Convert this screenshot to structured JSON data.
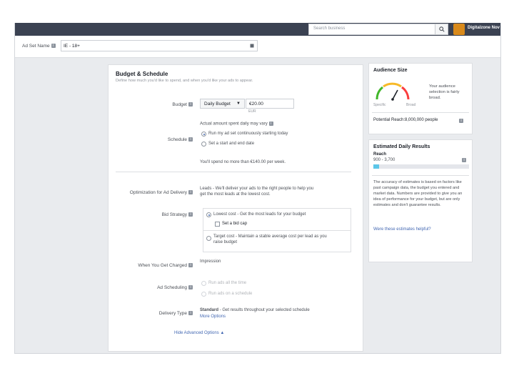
{
  "header": {
    "search_placeholder": "Search business",
    "avatar_text": "",
    "account_name": "Digitalzone Nov"
  },
  "adset": {
    "label": "Ad Set Name",
    "value": "IE - 18+"
  },
  "budget": {
    "title": "Budget & Schedule",
    "subtitle": "Define how much you'd like to spend, and when you'd like your ads to appear.",
    "budget_label": "Budget",
    "budget_type": "Daily Budget",
    "budget_amount": "€20.00",
    "currency": "EUR",
    "schedule_label": "Schedule",
    "actual_spend_note": "Actual amount spent daily may vary",
    "schedule_options": [
      "Run my ad set continuously starting today",
      "Set a start and end date"
    ],
    "spend_summary": "You'll spend no more than €140.00 per week."
  },
  "optimization": {
    "label": "Optimization for Ad Delivery",
    "text_line1": "Leads - We'll deliver your ads to the right people to help you",
    "text_line2": "get the most leads at the lowest cost."
  },
  "bid": {
    "label": "Bid Strategy",
    "lowest_cost": "Lowest cost - Get the most leads for your budget",
    "bid_cap": "Set a bid cap",
    "target_cost_line1": "Target cost - Maintain a stable average cost per lead as you",
    "target_cost_line2": "raise budget"
  },
  "charged": {
    "label": "When You Get Charged",
    "value": "Impression"
  },
  "ad_scheduling": {
    "label": "Ad Scheduling",
    "options": [
      "Run ads all the time",
      "Run ads on a schedule"
    ]
  },
  "delivery": {
    "label": "Delivery Type",
    "value_bold": "Standard",
    "value_rest": " - Get results throughout your selected schedule",
    "more_options": "More Options"
  },
  "hide_advanced": "Hide Advanced Options ▲",
  "audience": {
    "title": "Audience Size",
    "description": "Your audience selection is fairly broad.",
    "specific": "Specific",
    "broad": "Broad",
    "potential_reach": "Potential Reach:8,000,000 people"
  },
  "estimated": {
    "title": "Estimated Daily Results",
    "reach_label": "Reach",
    "reach_value": "900 - 3,700",
    "reach_fill": 0.06,
    "disclaimer": "The accuracy of estimates is based on factors like past campaign data, the budget you entered and market data. Numbers are provided to give you an idea of performance for your budget, but are only estimates and don't guarantee results.",
    "helpful_link": "Were these estimates helpful?"
  },
  "colors": {
    "topbar": "#3b4252",
    "link": "#4267b2",
    "gauge_green": "#42b72a",
    "gauge_red": "#fa3e3e",
    "gauge_yellow": "#f7b928",
    "reach_bar": "#5cc6e8"
  }
}
